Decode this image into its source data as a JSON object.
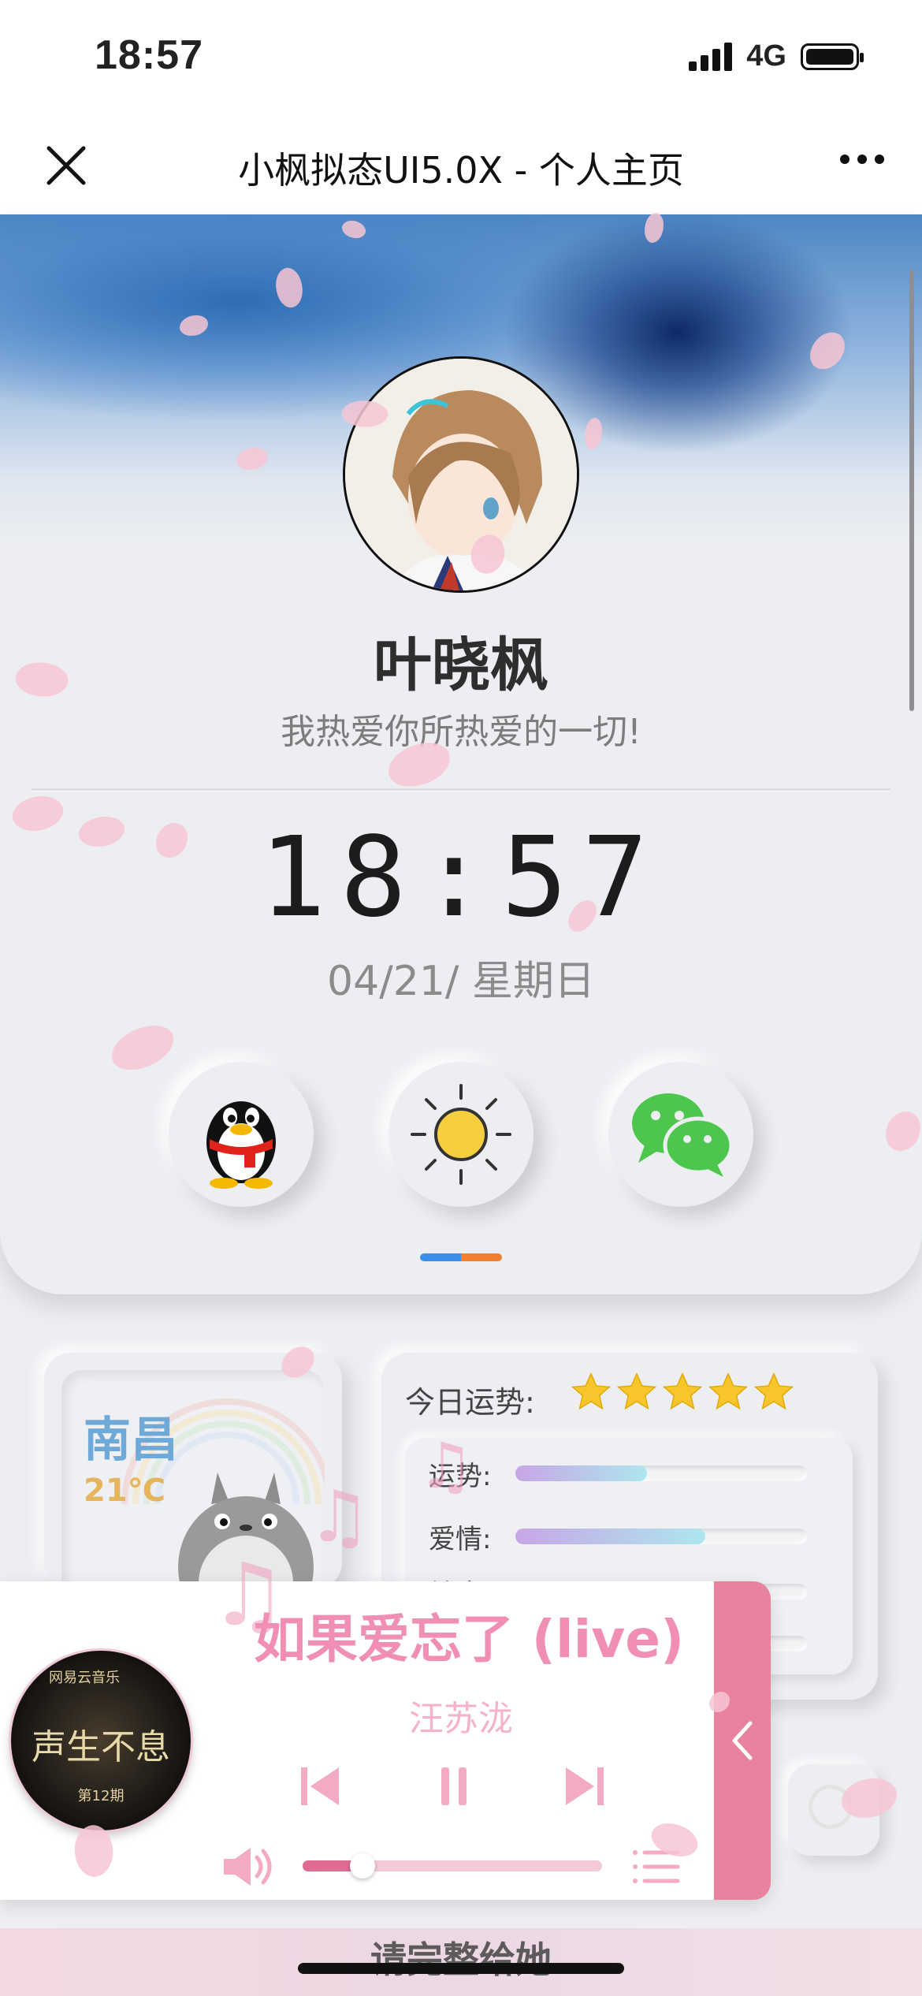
{
  "status_bar": {
    "time": "18:57",
    "network": "4G"
  },
  "nav": {
    "title": "小枫拟态UI5.0X - 个人主页"
  },
  "profile": {
    "name": "叶晓枫",
    "motto": "我热爱你所热爱的一切!",
    "clock": "18:57",
    "date": "04/21/ 星期日"
  },
  "apps": [
    {
      "icon": "qq-penguin-icon"
    },
    {
      "icon": "sun-icon"
    },
    {
      "icon": "wechat-icon"
    }
  ],
  "colors": {
    "page_dot_blue": "#3b8fe8",
    "page_dot_orange": "#f07f2e",
    "accent_pink": "#e8829e"
  },
  "weather": {
    "city": "南昌",
    "temperature": "21℃"
  },
  "fortune": {
    "title": "今日运势:",
    "stars": 5,
    "rows": [
      {
        "label": "运势:",
        "level": 0.45
      },
      {
        "label": "爱情:",
        "level": 0.65
      },
      {
        "label": "健康:",
        "level": 0.85
      },
      {
        "label": "",
        "level": 0.2
      }
    ]
  },
  "player": {
    "song": "如果爱忘了 (live)",
    "artist": "汪苏泷",
    "album_label": "网易云音乐",
    "album_title": "声生不息",
    "album_episode": "第12期",
    "progress": 0.2
  },
  "bottom": {
    "text": "请完整给她"
  }
}
